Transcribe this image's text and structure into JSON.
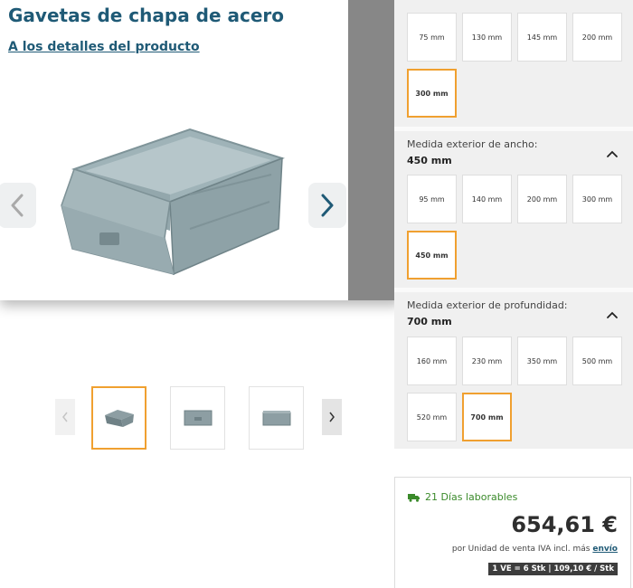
{
  "product": {
    "title": "Gavetas de chapa de acero",
    "details_link": "A los detalles del producto"
  },
  "icons": {
    "prev": "chevron-left-icon",
    "next": "chevron-right-icon",
    "collapse": "chevron-up-icon",
    "delivery": "truck-icon"
  },
  "options": {
    "height": {
      "values": [
        "75 mm",
        "130 mm",
        "145 mm",
        "200 mm",
        "300 mm"
      ],
      "selected": "300 mm"
    },
    "width": {
      "label": "Medida exterior de ancho:",
      "selected_display": "450 mm",
      "values": [
        "95 mm",
        "140 mm",
        "200 mm",
        "300 mm",
        "450 mm"
      ],
      "selected": "450 mm"
    },
    "depth": {
      "label": "Medida exterior de profundidad:",
      "selected_display": "700 mm",
      "values": [
        "160 mm",
        "230 mm",
        "350 mm",
        "500 mm",
        "520 mm",
        "700 mm"
      ],
      "selected": "700 mm"
    }
  },
  "purchase": {
    "delivery": "21 Días laborables",
    "price": "654,61 €",
    "vat_text": "por Unidad de venta IVA incl. más",
    "shipping_link": "envío",
    "unit_info": "1 VE = 6 Stk |  109,10 € / Stk"
  },
  "colors": {
    "brand_blue": "#1f5a76",
    "selected_border": "#f0a030",
    "delivery_green": "#3a8a2a"
  }
}
